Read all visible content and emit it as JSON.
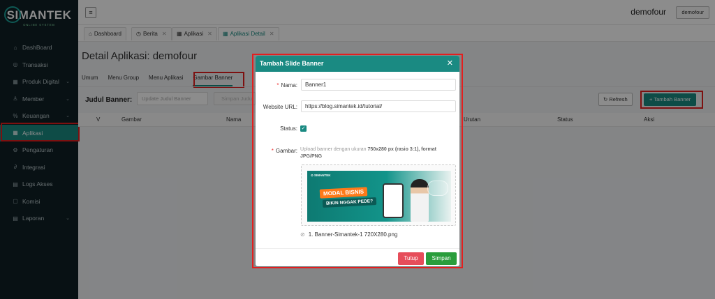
{
  "brand": {
    "name": "SIMANTEK",
    "tagline": "ONLINE SYSTEM"
  },
  "sidebar": {
    "items": [
      {
        "label": "DashBoard",
        "icon": "home-icon",
        "has_children": false
      },
      {
        "label": "Transaksi",
        "icon": "transaction-icon",
        "has_children": false
      },
      {
        "label": "Produk Digital",
        "icon": "grid-icon",
        "has_children": true
      },
      {
        "label": "Member",
        "icon": "member-icon",
        "has_children": true
      },
      {
        "label": "Keuangan",
        "icon": "finance-icon",
        "has_children": true
      },
      {
        "label": "Aplikasi",
        "icon": "apps-icon",
        "has_children": false,
        "active": true
      },
      {
        "label": "Pengaturan",
        "icon": "gear-icon",
        "has_children": false
      },
      {
        "label": "Integrasi",
        "icon": "link-icon",
        "has_children": false
      },
      {
        "label": "Logs Akses",
        "icon": "document-icon",
        "has_children": false
      },
      {
        "label": "Komisi",
        "icon": "commission-icon",
        "has_children": false
      },
      {
        "label": "Laporan",
        "icon": "report-icon",
        "has_children": true
      }
    ]
  },
  "header": {
    "username": "demofour",
    "user_button": "demofour"
  },
  "tabs": [
    {
      "label": "Dashboard",
      "icon": "home-icon",
      "closable": false
    },
    {
      "label": "Berita",
      "icon": "clock-icon",
      "closable": true
    },
    {
      "label": "Aplikasi",
      "icon": "grid-icon",
      "closable": true
    },
    {
      "label": "Aplikasi Detail",
      "icon": "grid-icon",
      "closable": true,
      "active": true
    }
  ],
  "page": {
    "title": "Detail Aplikasi: demofour",
    "subtabs": [
      "Umum",
      "Menu Group",
      "Menu Aplikasi",
      "Gambar Banner"
    ],
    "active_subtab": "Gambar Banner",
    "judul_label": "Judul Banner:",
    "judul_placeholder": "Update Judul Banner",
    "simpan_judul": "Simpan Judul",
    "refresh_label": "Refresh",
    "add_label": "Tambah Banner",
    "table_headers": [
      "V",
      "Gambar",
      "Nama",
      "Urutan",
      "Status",
      "Aksi"
    ]
  },
  "modal": {
    "title": "Tambah Slide Banner",
    "fields": {
      "nama_label": "Nama:",
      "nama_value": "Banner1",
      "url_label": "Website URL:",
      "url_value": "https://blog.simantek.id/tutorial/",
      "status_label": "Status:",
      "status_checked": true,
      "gambar_label": "Gambar:"
    },
    "hint_prefix": "Upload banner dengan ukuran ",
    "hint_bold": "750x280 px (rasio 3:1), format JPG/PNG",
    "banner": {
      "headline": "MODAL BISNIS",
      "subline": "BIKIN NGGAK PEDE?"
    },
    "file_name": "1. Banner-Simantek-1 720X280.png",
    "tutup_label": "Tutup",
    "simpan_label": "Simpan"
  },
  "colors": {
    "accent": "#1a8a82",
    "sidebar_bg": "#0f1f26",
    "highlight": "#e41e1e",
    "danger": "#e64d5a",
    "success": "#2a9d3c"
  }
}
